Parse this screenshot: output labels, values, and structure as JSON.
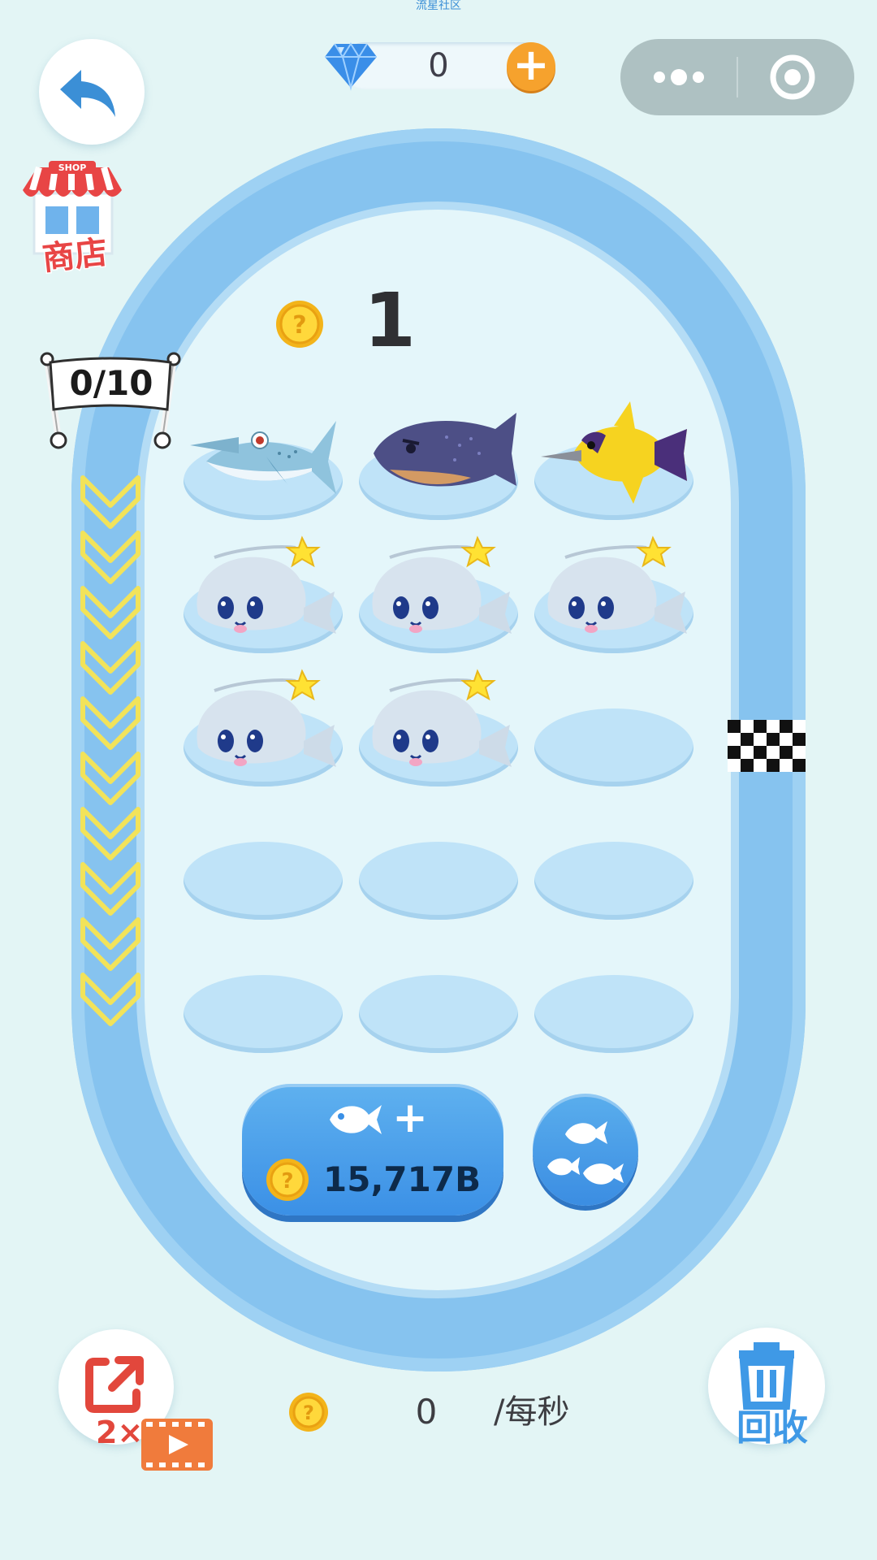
{
  "header": {
    "status_text": "流星社区",
    "gems": "0",
    "gem_plus": "+"
  },
  "shop": {
    "sign": "SHOP",
    "label": "商店"
  },
  "progress": {
    "label": "0/10",
    "current": 0,
    "total": 10
  },
  "level": {
    "value": "1"
  },
  "board": {
    "rows": 5,
    "cols": 3,
    "slots": [
      [
        "hammerhead-shark",
        "purple-grouper",
        "yellow-angelfish"
      ],
      [
        "anglerfish",
        "anglerfish",
        "anglerfish"
      ],
      [
        "anglerfish",
        "anglerfish",
        "empty"
      ],
      [
        "empty",
        "empty",
        "empty"
      ],
      [
        "empty",
        "empty",
        "empty"
      ]
    ]
  },
  "buy": {
    "plus": "+",
    "price": "15,717B"
  },
  "share": {
    "multiplier": "2×"
  },
  "income": {
    "value": "0",
    "unit": "/每秒"
  },
  "recycle": {
    "label": "回收"
  },
  "colors": {
    "background": "#e3f5f5",
    "track": "#86c3ef",
    "button_blue": "#3b90e6",
    "accent_orange": "#f6a22d",
    "chevron_yellow": "#f2e35a"
  },
  "icons": {
    "back": "back-arrow-icon",
    "gem": "diamond-icon",
    "capsule_more": "more-dots-icon",
    "capsule_close": "target-close-icon",
    "coin": "coin-icon",
    "share": "share-icon",
    "video": "video-play-icon",
    "recycle": "trash-icon",
    "merge": "fish-group-icon"
  }
}
